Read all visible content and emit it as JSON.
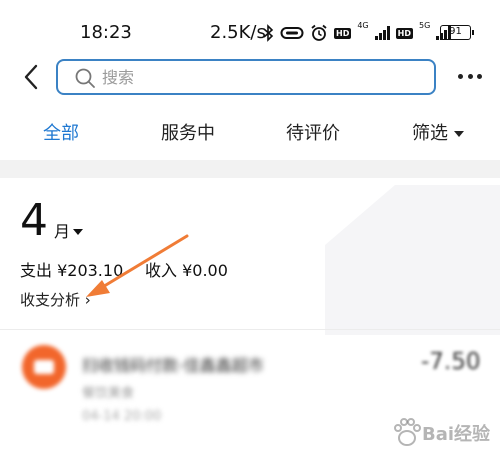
{
  "status_bar": {
    "time": "18:23",
    "net_speed": "2.5K/s",
    "net_badge_1": "HD",
    "net_gen_1": "4G",
    "net_badge_2": "HD",
    "net_gen_2": "5G",
    "battery": "91",
    "icons": [
      "bluetooth-icon",
      "vpn-link-icon",
      "alarm-icon",
      "signal-icon",
      "signal-icon"
    ]
  },
  "header": {
    "search_placeholder": "搜索"
  },
  "tabs": [
    {
      "label": "全部",
      "active": true
    },
    {
      "label": "服务中",
      "active": false
    },
    {
      "label": "待评价",
      "active": false
    },
    {
      "label": "筛选",
      "active": false
    }
  ],
  "month": {
    "number": "4",
    "unit": "月",
    "expense_text": "支出 ¥203.10",
    "income_text": "收入 ¥0.00",
    "analysis_link": "收支分析 ›"
  },
  "transaction": {
    "title": "扫收钱码付款-佳鑫鑫超市",
    "category": "餐饮美食",
    "time": "04-14 20:00",
    "amount": "-7.50"
  },
  "watermark": {
    "text": "Bai经验"
  },
  "colors": {
    "accent": "#1f78d1",
    "arrow": "#f07c36",
    "tx_icon": "#f2662b",
    "search_border": "#3b82c4"
  }
}
